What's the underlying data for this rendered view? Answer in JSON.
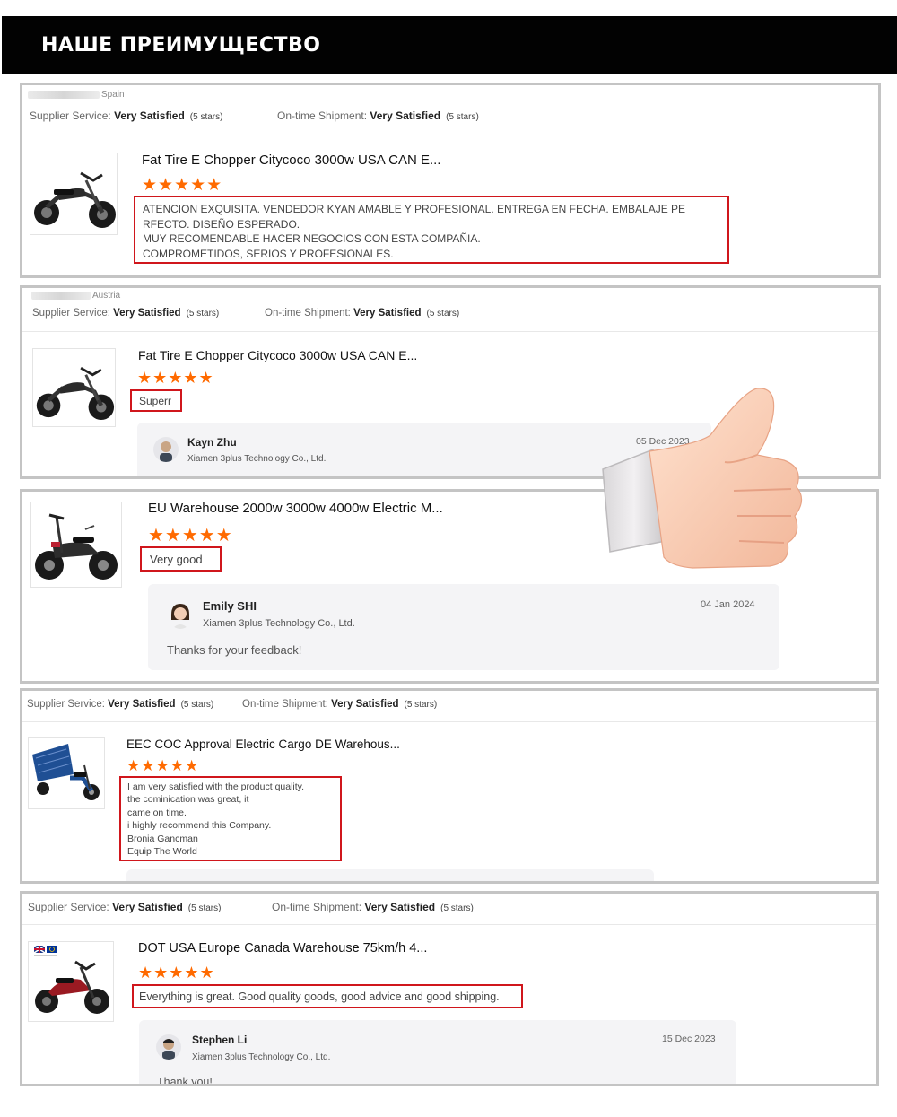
{
  "banner": {
    "title": "НАШЕ ПРЕИМУЩЕСТВО"
  },
  "reviews": [
    {
      "country": "Spain",
      "supplier_service_label": "Supplier Service:",
      "supplier_service_value": "Very Satisfied",
      "supplier_service_stars": "(5 stars)",
      "shipment_label": "On-time Shipment:",
      "shipment_value": "Very Satisfied",
      "shipment_stars": "(5 stars)",
      "product_title": "Fat Tire E Chopper Citycoco 3000w USA CAN E...",
      "rating": 5,
      "stars": "★★★★★",
      "review_text": "ATENCION EXQUISITA. VENDEDOR KYAN AMABLE Y PROFESIONAL. ENTREGA EN FECHA. EMBALAJE PE\nRFECTO. DISEÑO ESPERADO.\nMUY RECOMENDABLE HACER NEGOCIOS CON ESTA COMPAÑIA.\nCOMPROMETIDOS, SERIOS Y PROFESIONALES."
    },
    {
      "country": "Austria",
      "supplier_service_label": "Supplier Service:",
      "supplier_service_value": "Very Satisfied",
      "supplier_service_stars": "(5 stars)",
      "shipment_label": "On-time Shipment:",
      "shipment_value": "Very Satisfied",
      "shipment_stars": "(5 stars)",
      "product_title": "Fat Tire E Chopper Citycoco 3000w USA CAN E...",
      "rating": 5,
      "stars": "★★★★★",
      "review_text": "Superr",
      "reply": {
        "name": "Kayn Zhu",
        "company": "Xiamen 3plus Technology Co., Ltd.",
        "date": "05 Dec 2023"
      }
    },
    {
      "product_title": "EU Warehouse 2000w 3000w 4000w Electric M...",
      "rating": 5,
      "stars": "★★★★★",
      "review_text": "Very good",
      "reply": {
        "name": "Emily SHI",
        "company": "Xiamen 3plus Technology Co., Ltd.",
        "date": "04 Jan 2024",
        "message": "Thanks for your feedback!"
      }
    },
    {
      "supplier_service_label": "Supplier Service:",
      "supplier_service_value": "Very Satisfied",
      "supplier_service_stars": "(5 stars)",
      "shipment_label": "On-time Shipment:",
      "shipment_value": "Very Satisfied",
      "shipment_stars": "(5 stars)",
      "product_title": "EEC COC Approval Electric Cargo DE Warehous...",
      "rating": 5,
      "stars": "★★★★★",
      "review_text": "I am very satisfied with the product quality.\nthe cominication was great, it\ncame on time.\ni highly recommend this Company.\nBronia Gancman\nEquip The World"
    },
    {
      "supplier_service_label": "Supplier Service:",
      "supplier_service_value": "Very Satisfied",
      "supplier_service_stars": "(5 stars)",
      "shipment_label": "On-time Shipment:",
      "shipment_value": "Very Satisfied",
      "shipment_stars": "(5 stars)",
      "product_title": "DOT USA Europe Canada Warehouse 75km/h 4...",
      "rating": 5,
      "stars": "★★★★★",
      "review_text": "Everything is great. Good quality goods, good advice and good shipping.",
      "reply": {
        "name": "Stephen Li",
        "company": "Xiamen 3plus Technology Co., Ltd.",
        "date": "15 Dec 2023",
        "message": "Thank you!"
      }
    }
  ],
  "colors": {
    "accent_star": "#ff6a00",
    "highlight_box": "#d0161c",
    "banner_bg": "#020202",
    "card_border": "#c4c4c4"
  },
  "icons": [
    "thumbs-up-hand-icon",
    "scooter-image",
    "cargo-trike-image",
    "flag-uk-icon",
    "flag-eu-icon"
  ]
}
